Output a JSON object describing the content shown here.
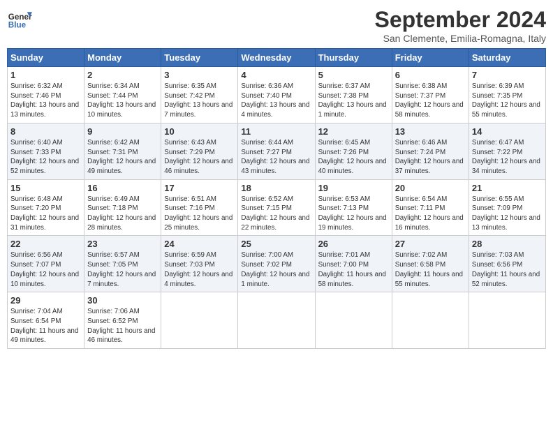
{
  "header": {
    "logo_line1": "General",
    "logo_line2": "Blue",
    "month": "September 2024",
    "location": "San Clemente, Emilia-Romagna, Italy"
  },
  "days_of_week": [
    "Sunday",
    "Monday",
    "Tuesday",
    "Wednesday",
    "Thursday",
    "Friday",
    "Saturday"
  ],
  "weeks": [
    [
      {
        "num": "1",
        "sunrise": "6:32 AM",
        "sunset": "7:46 PM",
        "daylight": "13 hours and 13 minutes."
      },
      {
        "num": "2",
        "sunrise": "6:34 AM",
        "sunset": "7:44 PM",
        "daylight": "13 hours and 10 minutes."
      },
      {
        "num": "3",
        "sunrise": "6:35 AM",
        "sunset": "7:42 PM",
        "daylight": "13 hours and 7 minutes."
      },
      {
        "num": "4",
        "sunrise": "6:36 AM",
        "sunset": "7:40 PM",
        "daylight": "13 hours and 4 minutes."
      },
      {
        "num": "5",
        "sunrise": "6:37 AM",
        "sunset": "7:38 PM",
        "daylight": "13 hours and 1 minute."
      },
      {
        "num": "6",
        "sunrise": "6:38 AM",
        "sunset": "7:37 PM",
        "daylight": "12 hours and 58 minutes."
      },
      {
        "num": "7",
        "sunrise": "6:39 AM",
        "sunset": "7:35 PM",
        "daylight": "12 hours and 55 minutes."
      }
    ],
    [
      {
        "num": "8",
        "sunrise": "6:40 AM",
        "sunset": "7:33 PM",
        "daylight": "12 hours and 52 minutes."
      },
      {
        "num": "9",
        "sunrise": "6:42 AM",
        "sunset": "7:31 PM",
        "daylight": "12 hours and 49 minutes."
      },
      {
        "num": "10",
        "sunrise": "6:43 AM",
        "sunset": "7:29 PM",
        "daylight": "12 hours and 46 minutes."
      },
      {
        "num": "11",
        "sunrise": "6:44 AM",
        "sunset": "7:27 PM",
        "daylight": "12 hours and 43 minutes."
      },
      {
        "num": "12",
        "sunrise": "6:45 AM",
        "sunset": "7:26 PM",
        "daylight": "12 hours and 40 minutes."
      },
      {
        "num": "13",
        "sunrise": "6:46 AM",
        "sunset": "7:24 PM",
        "daylight": "12 hours and 37 minutes."
      },
      {
        "num": "14",
        "sunrise": "6:47 AM",
        "sunset": "7:22 PM",
        "daylight": "12 hours and 34 minutes."
      }
    ],
    [
      {
        "num": "15",
        "sunrise": "6:48 AM",
        "sunset": "7:20 PM",
        "daylight": "12 hours and 31 minutes."
      },
      {
        "num": "16",
        "sunrise": "6:49 AM",
        "sunset": "7:18 PM",
        "daylight": "12 hours and 28 minutes."
      },
      {
        "num": "17",
        "sunrise": "6:51 AM",
        "sunset": "7:16 PM",
        "daylight": "12 hours and 25 minutes."
      },
      {
        "num": "18",
        "sunrise": "6:52 AM",
        "sunset": "7:15 PM",
        "daylight": "12 hours and 22 minutes."
      },
      {
        "num": "19",
        "sunrise": "6:53 AM",
        "sunset": "7:13 PM",
        "daylight": "12 hours and 19 minutes."
      },
      {
        "num": "20",
        "sunrise": "6:54 AM",
        "sunset": "7:11 PM",
        "daylight": "12 hours and 16 minutes."
      },
      {
        "num": "21",
        "sunrise": "6:55 AM",
        "sunset": "7:09 PM",
        "daylight": "12 hours and 13 minutes."
      }
    ],
    [
      {
        "num": "22",
        "sunrise": "6:56 AM",
        "sunset": "7:07 PM",
        "daylight": "12 hours and 10 minutes."
      },
      {
        "num": "23",
        "sunrise": "6:57 AM",
        "sunset": "7:05 PM",
        "daylight": "12 hours and 7 minutes."
      },
      {
        "num": "24",
        "sunrise": "6:59 AM",
        "sunset": "7:03 PM",
        "daylight": "12 hours and 4 minutes."
      },
      {
        "num": "25",
        "sunrise": "7:00 AM",
        "sunset": "7:02 PM",
        "daylight": "12 hours and 1 minute."
      },
      {
        "num": "26",
        "sunrise": "7:01 AM",
        "sunset": "7:00 PM",
        "daylight": "11 hours and 58 minutes."
      },
      {
        "num": "27",
        "sunrise": "7:02 AM",
        "sunset": "6:58 PM",
        "daylight": "11 hours and 55 minutes."
      },
      {
        "num": "28",
        "sunrise": "7:03 AM",
        "sunset": "6:56 PM",
        "daylight": "11 hours and 52 minutes."
      }
    ],
    [
      {
        "num": "29",
        "sunrise": "7:04 AM",
        "sunset": "6:54 PM",
        "daylight": "11 hours and 49 minutes."
      },
      {
        "num": "30",
        "sunrise": "7:06 AM",
        "sunset": "6:52 PM",
        "daylight": "11 hours and 46 minutes."
      },
      null,
      null,
      null,
      null,
      null
    ]
  ]
}
